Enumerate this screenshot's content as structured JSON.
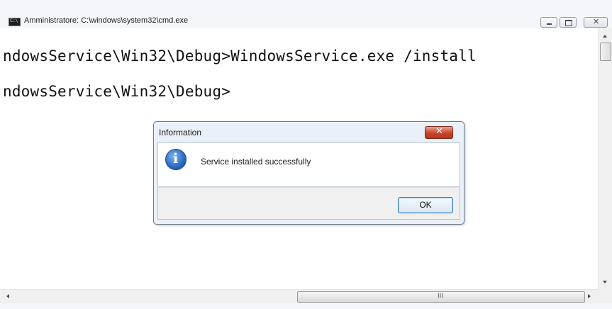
{
  "window": {
    "title": "Amministratore: C:\\windows\\system32\\cmd.exe",
    "icon_text": "C:\\",
    "icon_name": "cmd-console-icon"
  },
  "controls": {
    "minimize_icon": "minimize-icon",
    "maximize_icon": "maximize-icon",
    "close_label": "✕"
  },
  "console": {
    "lines": [
      "ndowsService\\Win32\\Debug>WindowsService.exe /install",
      "ndowsService\\Win32\\Debug>"
    ]
  },
  "scrollbar": {
    "horizontal_grip": "III"
  },
  "dialog": {
    "title": "Information",
    "close_label": "✕",
    "icon": "info-icon",
    "message": "Service installed successfully",
    "ok_label": "OK"
  },
  "colors": {
    "console_background": "#ffffff",
    "console_text": "#111111",
    "dialog_close": "#c8452c",
    "info_icon": "#2c68c1"
  }
}
